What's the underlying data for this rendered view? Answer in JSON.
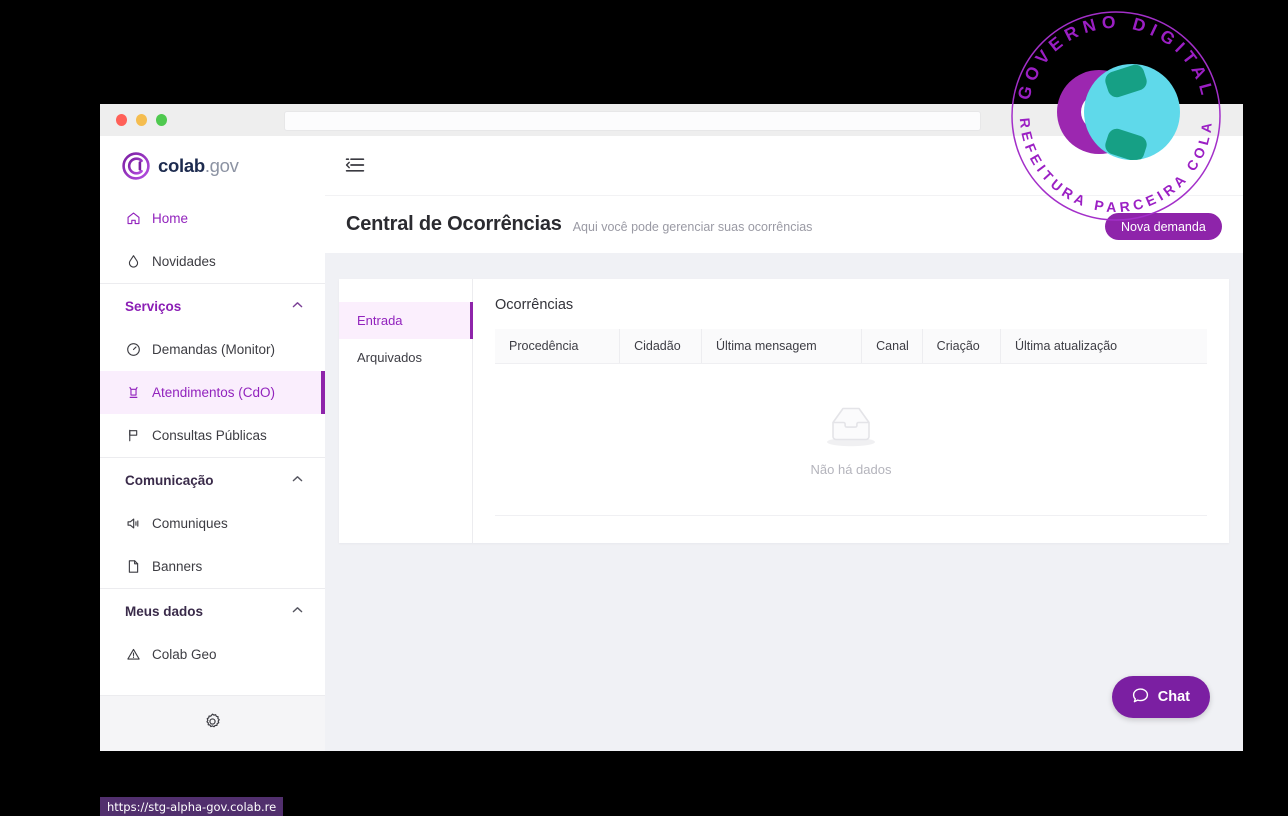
{
  "browser": {
    "traffic_lights": [
      "close",
      "minimize",
      "maximize"
    ],
    "url_value": "",
    "url_placeholder": "",
    "status_url": "https://stg-alpha-gov.colab.re"
  },
  "brand": {
    "logo_icon": "colab-circle-logo-icon",
    "name_bold": "colab",
    "name_light": ".gov"
  },
  "topbar": {
    "toggle_icon": "sidebar-collapse-icon"
  },
  "sidebar": {
    "items": [
      {
        "label": "Home",
        "icon": "home-icon",
        "type": "link",
        "state": "purple"
      },
      {
        "label": "Novidades",
        "icon": "flame-icon",
        "type": "link",
        "state": "normal"
      },
      {
        "label": "Serviços",
        "icon": "chevron-up-icon",
        "type": "group",
        "state": "purple"
      },
      {
        "label": "Demandas (Monitor)",
        "icon": "gauge-icon",
        "type": "link",
        "state": "normal"
      },
      {
        "label": "Atendimentos (CdO)",
        "icon": "megaphone-icon",
        "type": "link",
        "state": "active"
      },
      {
        "label": "Consultas Públicas",
        "icon": "flag-icon",
        "type": "link",
        "state": "normal"
      },
      {
        "label": "Comunicação",
        "icon": "chevron-up-icon",
        "type": "group",
        "state": "normal"
      },
      {
        "label": "Comuniques",
        "icon": "speaker-icon",
        "type": "link",
        "state": "normal"
      },
      {
        "label": "Banners",
        "icon": "document-icon",
        "type": "link",
        "state": "normal"
      },
      {
        "label": "Meus dados",
        "icon": "chevron-up-icon",
        "type": "group",
        "state": "normal"
      },
      {
        "label": "Colab Geo",
        "icon": "map-marker-icon",
        "type": "link",
        "state": "normal"
      }
    ],
    "footer_icon": "gear-icon"
  },
  "page": {
    "title": "Central de Ocorrências",
    "subtitle": "Aqui você pode gerenciar suas ocorrências",
    "new_demand_label": "Nova demanda"
  },
  "card": {
    "tabs": [
      {
        "label": "Entrada",
        "active": true
      },
      {
        "label": "Arquivados",
        "active": false
      }
    ],
    "panel_title": "Ocorrências",
    "table": {
      "columns": [
        "Procedência",
        "Cidadão",
        "Última mensagem",
        "Canal",
        "Criação",
        "Última atualização"
      ],
      "rows": [],
      "empty_text": "Não há dados",
      "empty_icon": "empty-inbox-icon"
    }
  },
  "chat": {
    "label": "Chat",
    "icon": "chat-bubble-icon"
  },
  "seal": {
    "top_text": "GOVERNO DIGITAL",
    "bottom_text": "PREFEITURA PARCEIRA COLAB",
    "icon": "colab-seal-icon"
  },
  "colors": {
    "brand_purple": "#8e24aa",
    "accent_purple": "#9223bd",
    "seal_cyan": "#5fd9ea",
    "seal_teal": "#16a085",
    "page_bg": "#f0f1f5"
  }
}
